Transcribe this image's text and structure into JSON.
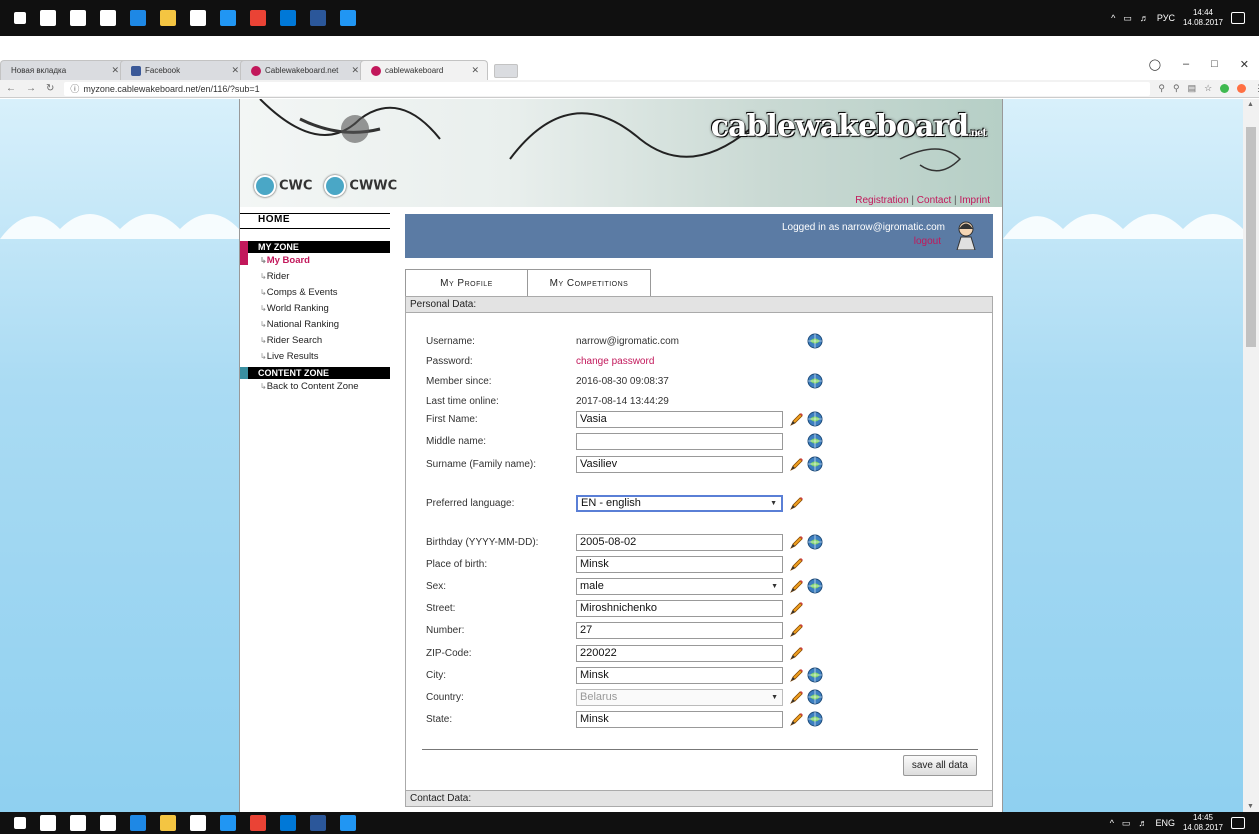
{
  "taskbar": {
    "top": {
      "tray_lang": "РУС",
      "time": "14:44",
      "date": "14.08.2017"
    },
    "bottom": {
      "tray_lang": "ENG",
      "time": "14:45",
      "date": "14.08.2017"
    },
    "app_icon_colors": [
      "#ffffff",
      "#ffffff",
      "#ffffff",
      "#ffffff",
      "#1e88e5",
      "#f4c542",
      "#ffffff",
      "#2196f3",
      "#ea4335",
      "#0078d7",
      "#2b579a",
      "#2196f3"
    ]
  },
  "browser": {
    "tabs": [
      {
        "title": "Новая вкладка",
        "favicon": "none",
        "active": false
      },
      {
        "title": "Facebook",
        "favicon": "fb",
        "active": false
      },
      {
        "title": "Cablewakeboard.net",
        "favicon": "cw",
        "active": false
      },
      {
        "title": "cablewakeboard",
        "favicon": "cw",
        "active": true
      }
    ],
    "url": "myzone.cablewakeboard.net/en/116/?sub=1",
    "window_controls": [
      "minimize-icon",
      "maximize-icon",
      "close-icon"
    ]
  },
  "site": {
    "brand": "cablewakeboard",
    "brand_suffix": ".net",
    "logos": [
      "CWC",
      "CWWC"
    ],
    "toplinks": {
      "registration": "Registration",
      "contact": "Contact",
      "imprint": "Imprint",
      "sep": "|"
    },
    "nav": {
      "home": "HOME",
      "my_zone": "MY ZONE",
      "my_zone_items": [
        "My Board",
        "Rider",
        "Comps & Events",
        "World Ranking",
        "National Ranking",
        "Rider Search",
        "Live Results"
      ],
      "content_zone": "CONTENT ZONE",
      "content_zone_items": [
        "Back to Content Zone"
      ]
    },
    "login": {
      "text": "Logged in as narrow@igromatic.com",
      "logout": "logout"
    },
    "tabs": [
      "My Profile",
      "My Competitions"
    ],
    "personal_title": "Personal Data:",
    "fields": [
      {
        "label": "Username:",
        "value": "narrow@igromatic.com",
        "type": "text",
        "edit": false,
        "globe": true
      },
      {
        "label": "Password:",
        "value": "change password",
        "type": "link",
        "edit": false,
        "globe": false
      },
      {
        "label": "Member since:",
        "value": "2016-08-30 09:08:37",
        "type": "text",
        "edit": false,
        "globe": true
      },
      {
        "label": "Last time online:",
        "value": "2017-08-14 13:44:29",
        "type": "text",
        "edit": false,
        "globe": false
      },
      {
        "label": "First Name:",
        "value": "Vasia",
        "type": "input",
        "edit": true,
        "globe": true
      },
      {
        "label": "Middle name:",
        "value": "",
        "type": "input",
        "edit": false,
        "globe": true
      },
      {
        "label": "Surname (Family name):",
        "value": "Vasiliev",
        "type": "input",
        "edit": true,
        "globe": true
      },
      {
        "label": "Preferred language:",
        "value": "EN - english",
        "type": "select-focus",
        "edit": true,
        "globe": false
      },
      {
        "label": "Birthday (YYYY-MM-DD):",
        "value": "2005-08-02",
        "type": "input",
        "edit": true,
        "globe": true
      },
      {
        "label": "Place of birth:",
        "value": "Minsk",
        "type": "input",
        "edit": true,
        "globe": false
      },
      {
        "label": "Sex:",
        "value": "male",
        "type": "select",
        "edit": true,
        "globe": true
      },
      {
        "label": "Street:",
        "value": "Miroshnichenko",
        "type": "input",
        "edit": true,
        "globe": false
      },
      {
        "label": "Number:",
        "value": "27",
        "type": "input",
        "edit": true,
        "globe": false
      },
      {
        "label": "ZIP-Code:",
        "value": "220022",
        "type": "input",
        "edit": true,
        "globe": false
      },
      {
        "label": "City:",
        "value": "Minsk",
        "type": "input",
        "edit": true,
        "globe": true
      },
      {
        "label": "Country:",
        "value": "Belarus",
        "type": "select-disabled",
        "edit": true,
        "globe": true
      },
      {
        "label": "State:",
        "value": "Minsk",
        "type": "input",
        "edit": true,
        "globe": true
      }
    ],
    "save_label": "save all data",
    "contact_title": "Contact Data:"
  },
  "colors": {
    "accent": "#c2185b",
    "login_bar": "#5b7ba4",
    "sky": "#8fd0f0"
  }
}
